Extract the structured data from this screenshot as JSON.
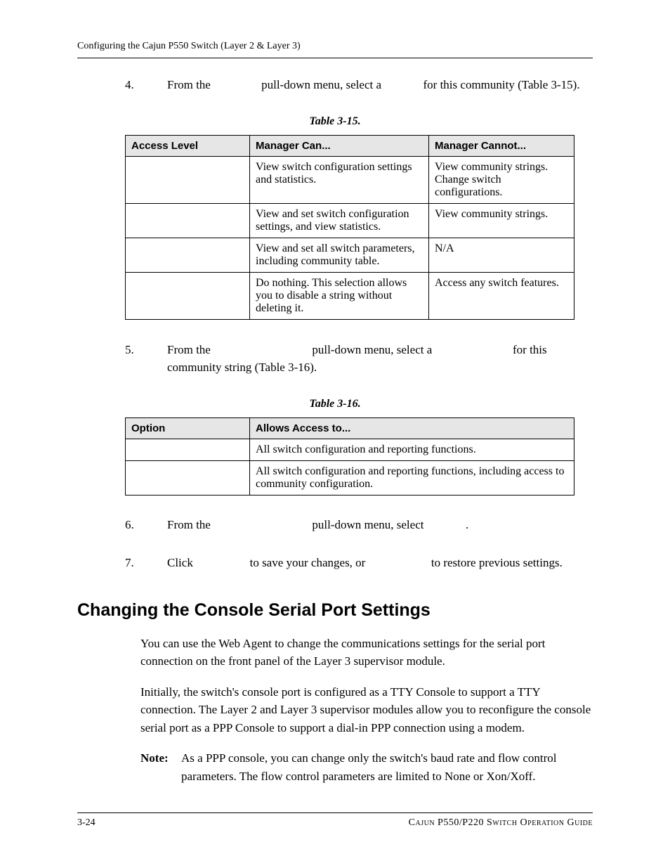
{
  "header": {
    "text": "Configuring the Cajun P550 Switch (Layer 2 & Layer 3)"
  },
  "step4": {
    "num": "4.",
    "pre": "From the ",
    "mid1": " pull-down menu, select a ",
    "post": " for this community (Table 3-15)."
  },
  "table15": {
    "caption": "Table 3-15.",
    "headers": {
      "a": "Access Level",
      "b": "Manager Can...",
      "c": "Manager Cannot..."
    },
    "rows": [
      {
        "a": "",
        "b": "View switch configuration settings and statistics.",
        "c": "View community strings. Change switch configurations."
      },
      {
        "a": "",
        "b": "View and set switch configuration settings, and view statistics.",
        "c": "View community strings."
      },
      {
        "a": "",
        "b": "View and set all switch parameters, including community table.",
        "c": "N/A"
      },
      {
        "a": "",
        "b": "Do nothing. This selection allows you to disable a string without deleting it.",
        "c": "Access any switch features."
      }
    ]
  },
  "step5": {
    "num": "5.",
    "pre": "From the ",
    "mid1": " pull-down menu, select a ",
    "post": " for this community string (Table 3-16)."
  },
  "table16": {
    "caption": "Table 3-16.",
    "headers": {
      "a": "Option",
      "b": "Allows Access to..."
    },
    "rows": [
      {
        "a": "",
        "b": "All switch configuration and reporting functions."
      },
      {
        "a": "",
        "b": "All switch configuration and reporting functions, including access to community configuration."
      }
    ]
  },
  "step6": {
    "num": "6.",
    "pre": "From the ",
    "mid1": " pull-down menu, select ",
    "post": "."
  },
  "step7": {
    "num": "7.",
    "pre": "Click ",
    "mid1": " to save your changes, or ",
    "post": " to restore previous settings."
  },
  "section": {
    "title": "Changing the Console Serial Port Settings"
  },
  "para1": "You can use the Web Agent to change the communications settings for the serial port connection on the front panel of the Layer 3 supervisor module.",
  "para2": "Initially, the switch's console port is configured as a TTY Console to support a TTY connection. The Layer 2 and Layer 3 supervisor modules allow you to reconfigure the console serial port as a PPP Console to support a dial-in PPP connection using a modem.",
  "note": {
    "label": "Note:",
    "body": "As a PPP console, you can change only the switch's baud rate and flow control parameters. The flow control parameters are limited to None or Xon/Xoff."
  },
  "footer": {
    "left_chapter": "3",
    "left_page": "24",
    "right": "Cajun P550/P220 Switch Operation Guide"
  }
}
